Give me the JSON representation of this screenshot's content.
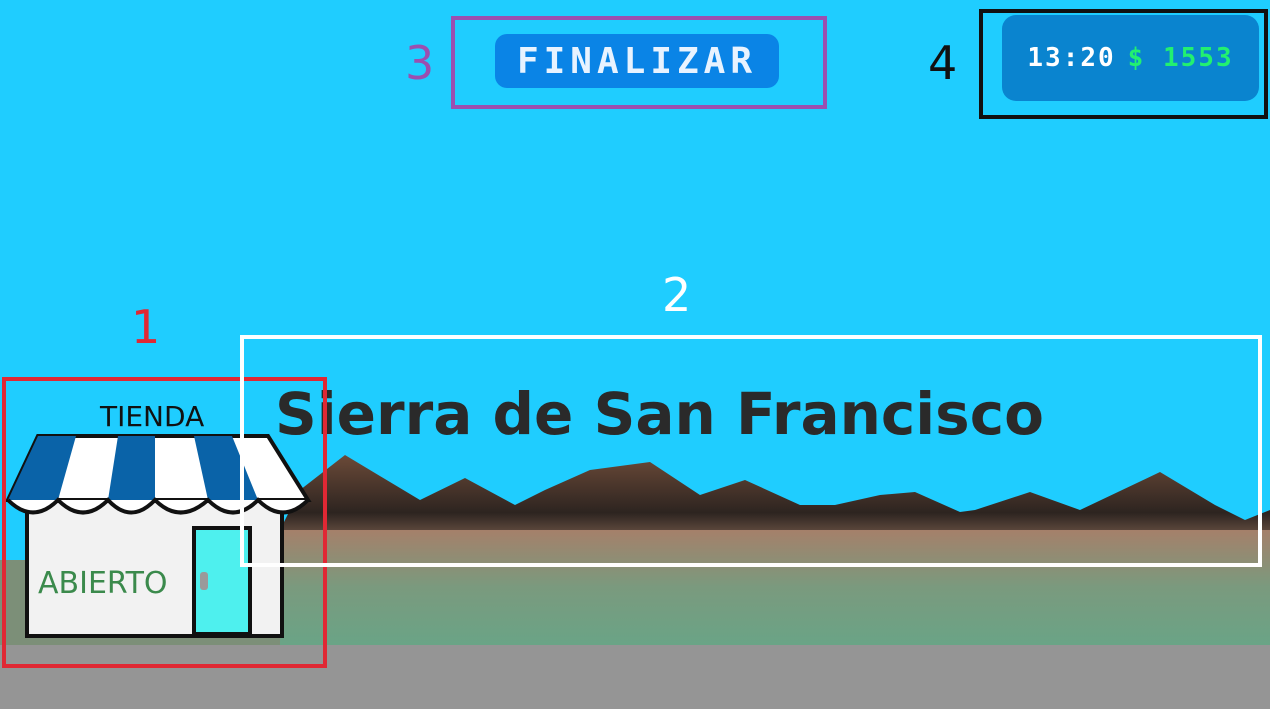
{
  "markers": {
    "shop": "1",
    "location": "2",
    "finish": "3",
    "hud": "4"
  },
  "colors": {
    "sky": "#1fcdff",
    "ground": "#959595",
    "marker_shop": "#e02834",
    "marker_location": "#ffffff",
    "marker_finish": "#9b4fb0",
    "marker_hud": "#111111",
    "money": "#22f070"
  },
  "finish_button": {
    "label": "FINALIZAR"
  },
  "hud": {
    "time": "13:20",
    "currency_symbol": "$",
    "money": "1553"
  },
  "location": {
    "name": "Sierra de San Francisco"
  },
  "shop": {
    "sign": "TIENDA",
    "status": "ABIERTO",
    "icon": "storefront-icon"
  }
}
